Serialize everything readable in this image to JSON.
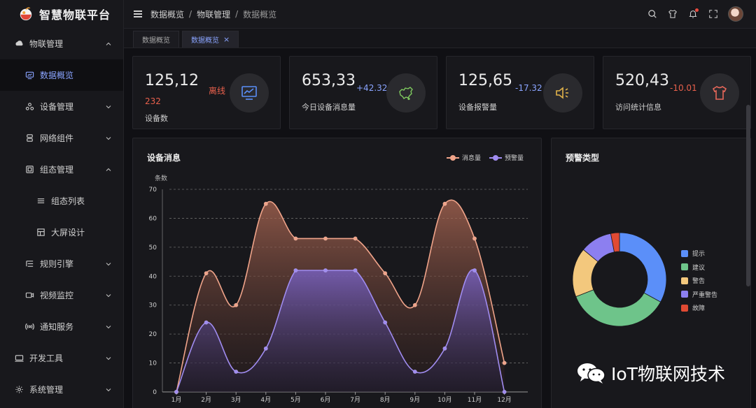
{
  "app": {
    "title": "智慧物联平台"
  },
  "sidebar": {
    "items": [
      {
        "label": "物联管理",
        "level": 0,
        "chevron": "up"
      },
      {
        "label": "数据概览",
        "level": 1,
        "active": true
      },
      {
        "label": "设备管理",
        "level": 1,
        "chevron": "down"
      },
      {
        "label": "网络组件",
        "level": 1,
        "chevron": "down"
      },
      {
        "label": "组态管理",
        "level": 1,
        "chevron": "up"
      },
      {
        "label": "组态列表",
        "level": 2
      },
      {
        "label": "大屏设计",
        "level": 2
      },
      {
        "label": "规则引擎",
        "level": 1,
        "chevron": "down"
      },
      {
        "label": "视频监控",
        "level": 1,
        "chevron": "down"
      },
      {
        "label": "通知服务",
        "level": 1,
        "chevron": "down"
      },
      {
        "label": "开发工具",
        "level": 0,
        "chevron": "down"
      },
      {
        "label": "系统管理",
        "level": 0,
        "chevron": "down"
      }
    ]
  },
  "header": {
    "breadcrumb": [
      "数据概览",
      "物联管理",
      "数据概览"
    ],
    "separator": "/"
  },
  "tabs": [
    {
      "label": "数据概览",
      "active": false
    },
    {
      "label": "数据概览",
      "active": true,
      "close": "×"
    }
  ],
  "stats": [
    {
      "value": "125,12",
      "delta": "离线",
      "delta2": "232",
      "label": "设备数",
      "color": "#e8604c",
      "icon": "monitor-chart-icon",
      "icon_color": "#5b8ff9"
    },
    {
      "value": "653,33",
      "delta": "+42.32",
      "label": "今日设备消息量",
      "color": "#8aa4ff",
      "icon": "china-map-icon",
      "icon_color": "#7ec85e"
    },
    {
      "value": "125,65",
      "delta": "-17.32",
      "label": "设备报警量",
      "color": "#8aa4ff",
      "icon": "speaker-icon",
      "icon_color": "#e2b34a"
    },
    {
      "value": "520,43",
      "delta": "-10.01",
      "label": "访问统计信息",
      "color": "#e8604c",
      "icon": "tshirt-icon",
      "icon_color": "#e8685a"
    }
  ],
  "panels": {
    "line_title": "设备消息",
    "pie_title": "预警类型"
  },
  "colors": {
    "series_messages": "#f0a48a",
    "series_alerts": "#a08cf0"
  },
  "watermark": {
    "text": "IoT物联网技术"
  },
  "chart_data": [
    {
      "type": "area",
      "title": "设备消息",
      "ylabel": "条数",
      "categories": [
        "1月",
        "2月",
        "3月",
        "4月",
        "5月",
        "6月",
        "7月",
        "8月",
        "9月",
        "10月",
        "11月",
        "12月"
      ],
      "ylim": [
        0,
        70
      ],
      "yticks": [
        0,
        10,
        20,
        30,
        40,
        50,
        60,
        70
      ],
      "grid": true,
      "legend": "top-right",
      "series": [
        {
          "name": "消息量",
          "values": [
            0,
            41,
            30,
            65,
            53,
            53,
            53,
            41,
            30,
            65,
            53,
            10
          ]
        },
        {
          "name": "预警量",
          "values": [
            0,
            24,
            7,
            15,
            42,
            42,
            42,
            24,
            7,
            15,
            42,
            0
          ]
        }
      ]
    },
    {
      "type": "pie",
      "title": "预警类型",
      "legend": "right",
      "slices": [
        {
          "name": "提示",
          "value": 33,
          "color": "#5b8ff9"
        },
        {
          "name": "建议",
          "value": 36,
          "color": "#6ec48a"
        },
        {
          "name": "警告",
          "value": 17,
          "color": "#f3c87d"
        },
        {
          "name": "严重警告",
          "value": 11,
          "color": "#8c7ff0"
        },
        {
          "name": "故障",
          "value": 3,
          "color": "#e04a33"
        }
      ]
    }
  ]
}
